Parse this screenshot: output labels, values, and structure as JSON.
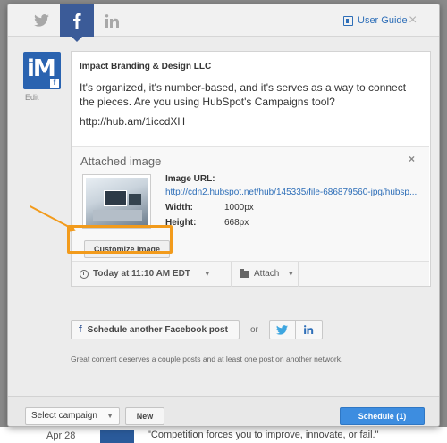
{
  "header": {
    "tabs": [
      {
        "name": "twitter",
        "icon": "twitter-icon"
      },
      {
        "name": "facebook",
        "icon": "facebook-icon",
        "active": true
      },
      {
        "name": "linkedin",
        "icon": "linkedin-icon"
      }
    ],
    "guide_label": "User Guide",
    "close_glyph": "×"
  },
  "account": {
    "edit_label": "Edit",
    "name": "Impact Branding & Design LLC"
  },
  "post": {
    "text": "It's organized, it's number-based, and it's serves as a way to connect the pieces. Are you using HubSpot's Campaigns tool?",
    "url": "http://hub.am/1iccdXH"
  },
  "attachment": {
    "title": "Attached image",
    "close_glyph": "×",
    "url_label": "Image URL:",
    "url_value": "http://cdn2.hubspot.net/hub/145335/file-686879560-jpg/hubsp...",
    "width_label": "Width:",
    "width_value": "1000px",
    "height_label": "Height:",
    "height_value": "668px",
    "customize_label": "Customize Image"
  },
  "composer_footer": {
    "schedule_time": "Today at 11:10 AM EDT",
    "attach_label": "Attach"
  },
  "share": {
    "schedule_fb_label": "Schedule another Facebook post",
    "or_label": "or",
    "hint": "Great content deserves a couple posts and at least one post on another network."
  },
  "bottom": {
    "campaign_placeholder": "Select campaign",
    "new_label": "New",
    "schedule_label": "Schedule (1)"
  },
  "background": {
    "date": "Apr 28",
    "quote": "\"Competition forces you to improve, innovate, or fail.\""
  },
  "colors": {
    "facebook_blue": "#3b5b98",
    "link_blue": "#2d6eb8",
    "highlight_orange": "#f29b1c",
    "primary_button": "#3d8de0"
  }
}
